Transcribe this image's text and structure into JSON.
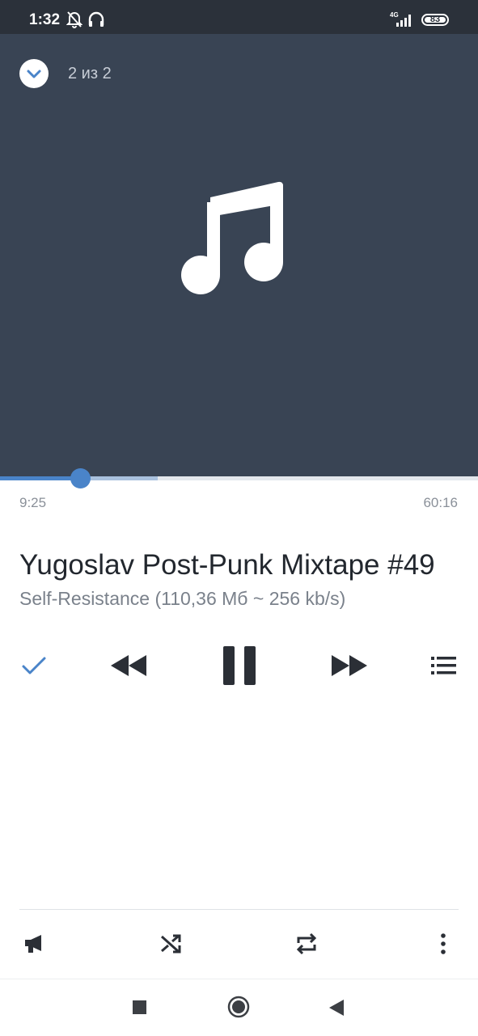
{
  "status_bar": {
    "time": "1:32",
    "network": "4G",
    "battery": "83"
  },
  "player": {
    "track_counter": "2 из 2",
    "elapsed": "9:25",
    "total": "60:16",
    "progress_fraction": 0.167,
    "buffer_fraction": 0.33,
    "title": "Yugoslav Post-Punk Mixtape #49",
    "subtitle": "Self-Resistance (110,36 Мб ~ 256 kb/s)"
  },
  "icons": {
    "collapse": "chevron-down-icon",
    "artwork": "music-note-icon",
    "added": "checkmark-icon",
    "previous": "rewind-icon",
    "play_pause": "pause-icon",
    "next": "fast-forward-icon",
    "queue": "playlist-icon",
    "broadcast": "megaphone-icon",
    "shuffle": "shuffle-icon",
    "repeat": "repeat-icon",
    "more": "more-vertical-icon"
  },
  "colors": {
    "accent": "#4a84c9",
    "artwork_bg": "#394454",
    "icon_dark": "#2b2f36"
  }
}
